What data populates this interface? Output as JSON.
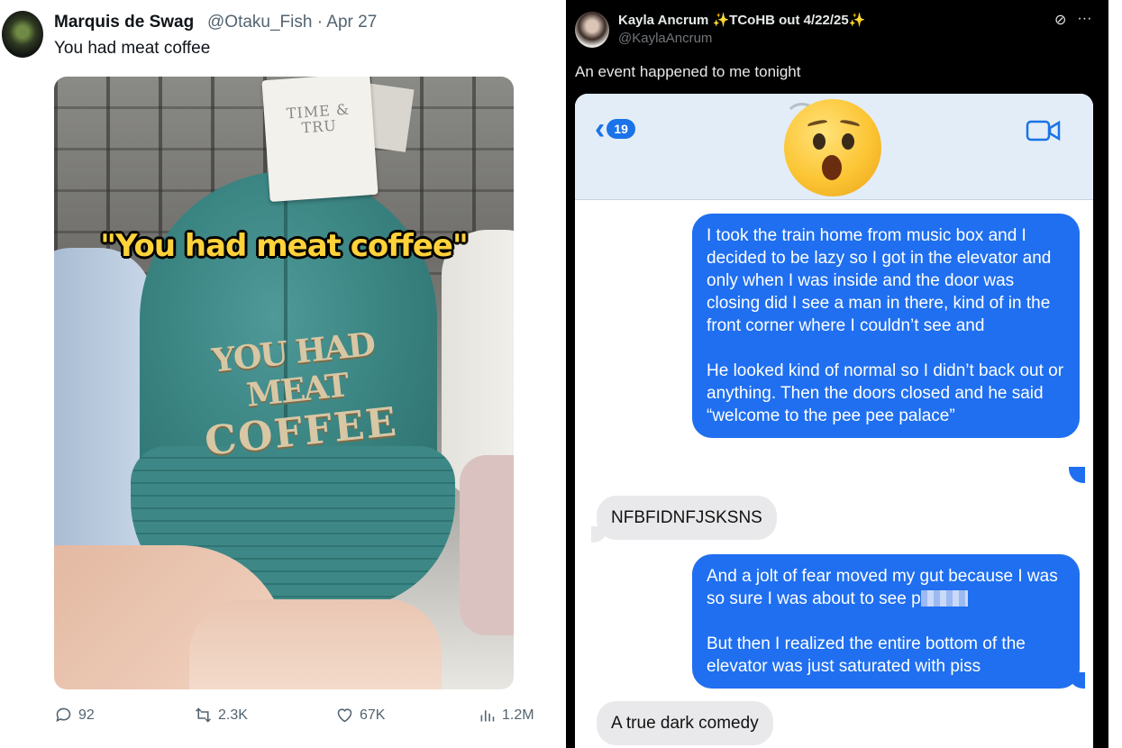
{
  "left_tweet": {
    "author_name": "Marquis de Swag",
    "author_handle": "@Otaku_Fish",
    "date": "Apr 27",
    "text": "You had meat coffee",
    "image": {
      "overlay_caption": "\"You had meat coffee\"",
      "tag_text": "TIME & TRU",
      "embroidery_line1": "YOU HAD MEAT",
      "embroidery_line2": "COFFEE"
    },
    "stats": {
      "replies": "92",
      "reposts": "2.3K",
      "likes": "67K",
      "views": "1.2M"
    }
  },
  "right_tweet": {
    "author_name": "Kayla Ancrum ✨TCoHB out 4/22/25✨",
    "author_handle": "@KaylaAncrum",
    "text": "An event happened to me tonight",
    "imessage": {
      "back_count": "19",
      "messages": [
        {
          "from": "me",
          "p1": "I took the train home from music box and I decided to be lazy so I got in the elevator and only when I was inside and the door was closing did I see a man in there, kind of in the front corner where I couldn’t see and",
          "p2": "He looked kind of normal so I didn’t back out or anything. Then the doors closed and he said “welcome to the pee pee palace”"
        },
        {
          "from": "them",
          "text": "NFBFIDNFJSKSNS"
        },
        {
          "from": "me",
          "p1": "And a jolt of fear moved my gut because I was so sure I was about to see p",
          "p2": "But then I realized the entire bottom of the elevator was just saturated with piss"
        },
        {
          "from": "them",
          "text": "A true dark comedy"
        }
      ]
    }
  },
  "colors": {
    "imessage_blue": "#1f6ff0",
    "imessage_gray": "#e9e9eb",
    "twitter_dark_bg": "#000000",
    "overlay_yellow": "#ffd23a"
  }
}
